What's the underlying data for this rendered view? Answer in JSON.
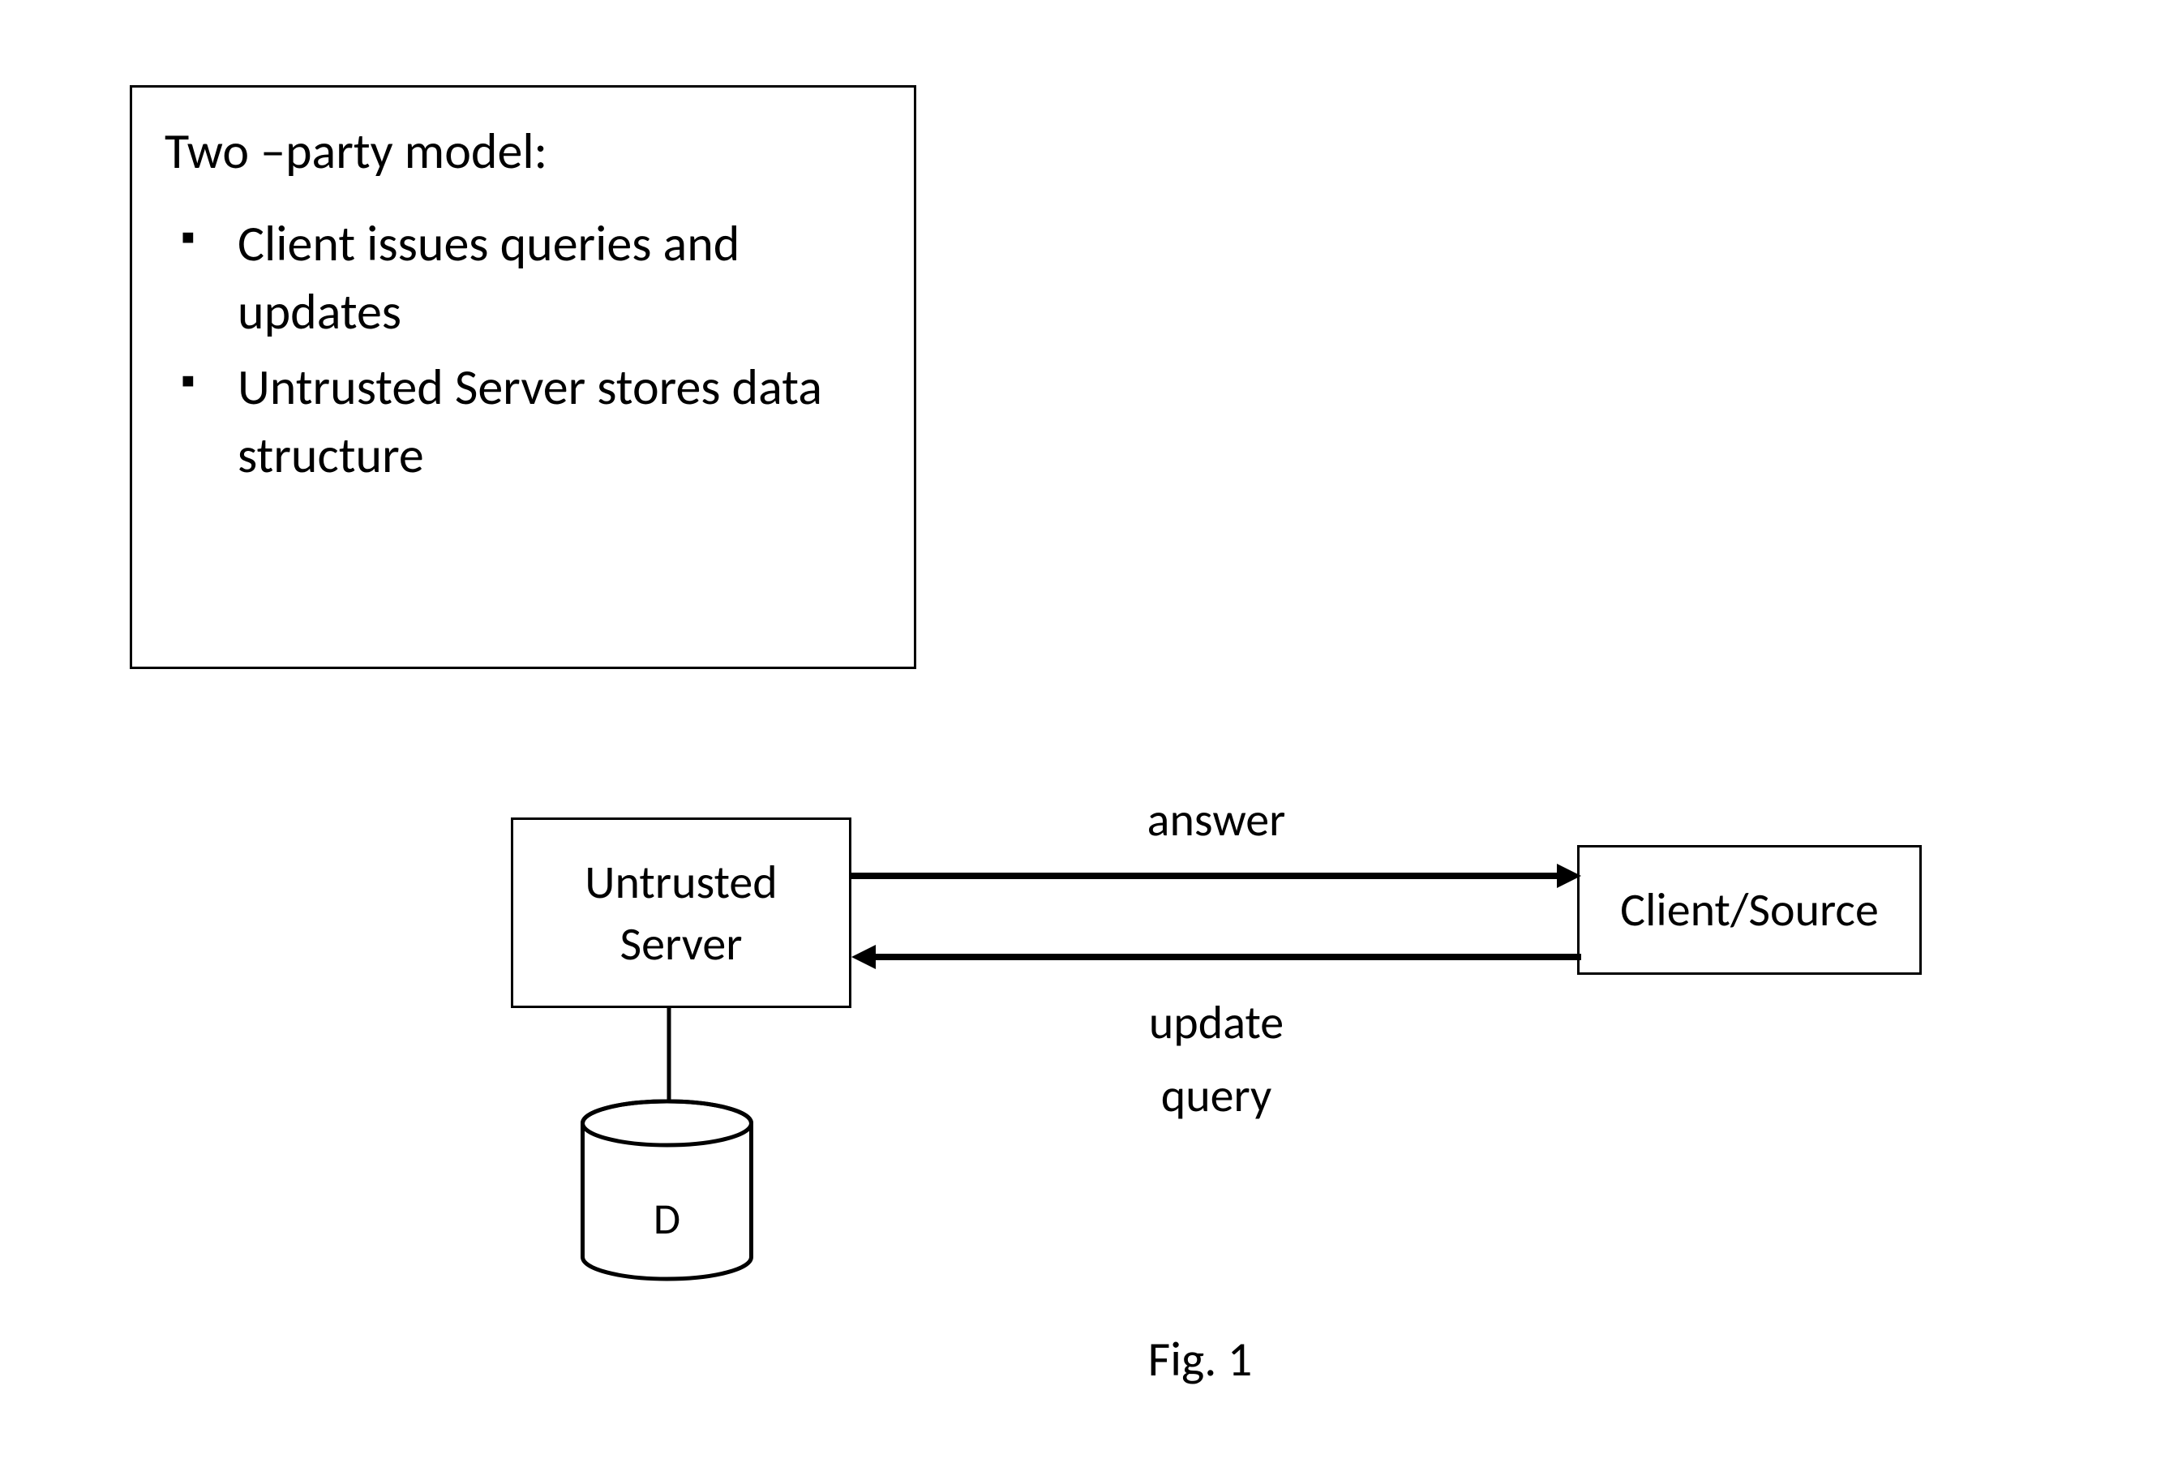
{
  "textbox": {
    "title": "Two –party model:",
    "bullets": [
      "Client issues queries and updates",
      "Untrusted Server stores data structure"
    ]
  },
  "diagram": {
    "server_box": {
      "line1": "Untrusted",
      "line2": "Server"
    },
    "client_box": {
      "label": "Client/Source"
    },
    "database": {
      "label": "D"
    },
    "arrows": {
      "top_label": "answer",
      "bottom_label_1": "update",
      "bottom_label_2": "query"
    },
    "caption": "Fig. 1"
  }
}
